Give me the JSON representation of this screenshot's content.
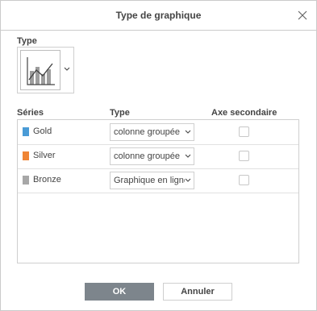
{
  "dialog": {
    "title": "Type de graphique",
    "type_label": "Type",
    "columns": {
      "series": "Séries",
      "type": "Type",
      "secondary_axis": "Axe secondaire"
    },
    "series": [
      {
        "name": "Gold",
        "color": "#4a9bd6",
        "type": "colonne groupée",
        "secondary_axis": false
      },
      {
        "name": "Silver",
        "color": "#ef8535",
        "type": "colonne groupée",
        "secondary_axis": false
      },
      {
        "name": "Bronze",
        "color": "#a7a7a7",
        "type": "Graphique en ligne",
        "secondary_axis": false
      }
    ],
    "buttons": {
      "ok": "OK",
      "cancel": "Annuler"
    }
  }
}
